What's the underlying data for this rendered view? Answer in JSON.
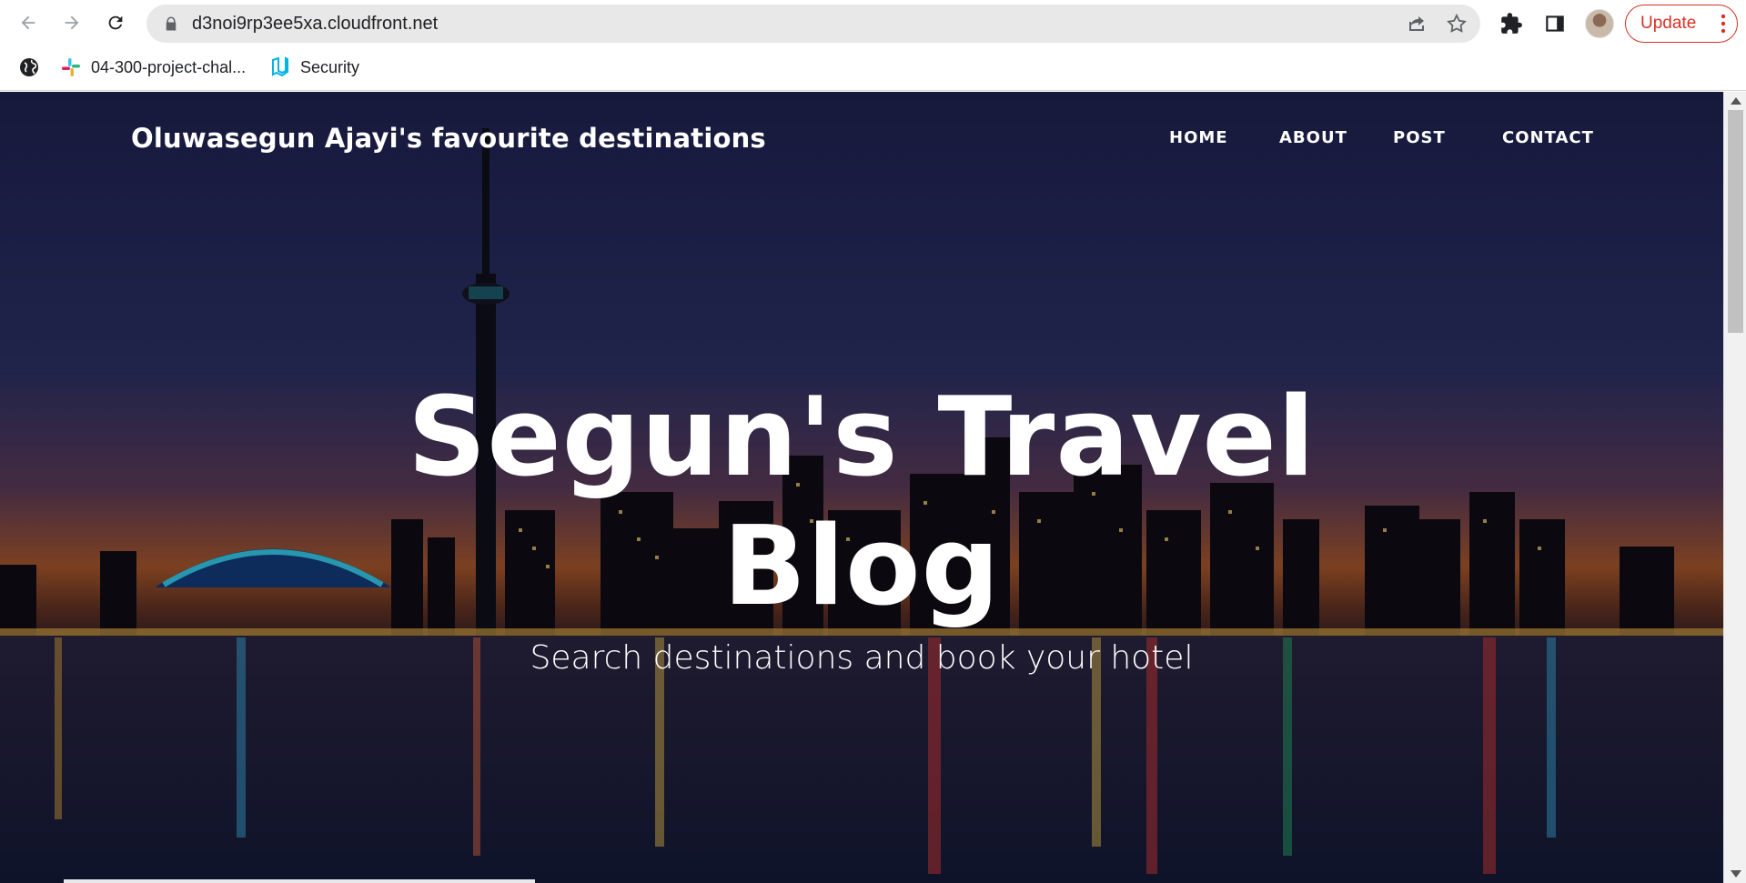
{
  "browser": {
    "url": "d3noi9rp3ee5xa.cloudfront.net",
    "update_label": "Update",
    "bookmarks": [
      {
        "label": "",
        "icon": "globe-icon"
      },
      {
        "label": "04-300-project-chal...",
        "icon": "slack-icon"
      },
      {
        "label": "Security",
        "icon": "udacity-icon"
      }
    ]
  },
  "site": {
    "title": "Oluwasegun Ajayi's favourite destinations",
    "nav": [
      "HOME",
      "ABOUT",
      "POST",
      "CONTACT"
    ]
  },
  "hero": {
    "title_line1": "Segun's Travel",
    "title_line2": "Blog",
    "subtitle": "Search destinations and book your hotel"
  },
  "colors": {
    "update_accent": "#d93025",
    "hero_text": "#ffffff"
  }
}
